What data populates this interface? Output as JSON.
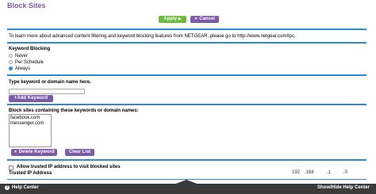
{
  "page": {
    "title": "Block Sites"
  },
  "toolbar": {
    "apply_label": "Apply",
    "cancel_label": "Cancel"
  },
  "info": {
    "text": "To learn more about advanced content filtering and keyword blocking features from NETGEAR, please go to http://www.netgear.com/lpc."
  },
  "keyword_blocking": {
    "heading": "Keyword Blocking",
    "options": [
      {
        "label": "Never",
        "selected": false
      },
      {
        "label": "Per Schedule",
        "selected": false
      },
      {
        "label": "Always",
        "selected": true
      }
    ]
  },
  "keyword_input": {
    "label": "Type keyword or domain name here.",
    "value": "",
    "add_label": "Add Keyword"
  },
  "blocked_list": {
    "label": "Block sites containing these keywords or domain names:",
    "items": [
      "facebook.com",
      "messenger.com"
    ],
    "delete_label": "Delete Keyword",
    "clear_label": "Clear List"
  },
  "trusted": {
    "checkbox_label": "Allow trusted IP address to visit blocked sites",
    "checked": false,
    "ip_label": "Trusted IP Address",
    "ip_octets": [
      "192",
      ".168",
      ".1",
      ".0"
    ]
  },
  "footer": {
    "help_label": "Help Center",
    "show_hide_label": "Show/Hide Help Center"
  },
  "colors": {
    "accent": "#7d5aa6",
    "apply": "#6ebc3d",
    "rule": "#2a8cd7",
    "footer": "#3a3a3a"
  }
}
